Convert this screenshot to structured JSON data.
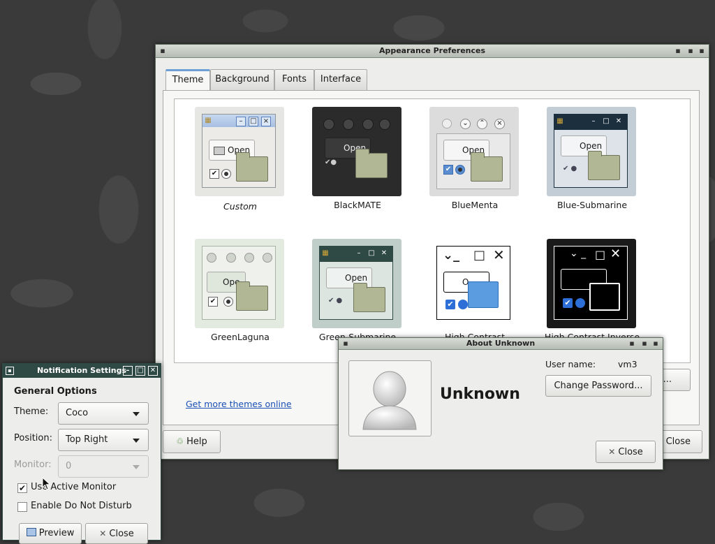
{
  "appearance": {
    "title": "Appearance Preferences",
    "tabs": [
      {
        "label": "Theme"
      },
      {
        "label": "Background"
      },
      {
        "label": "Fonts"
      },
      {
        "label": "Interface"
      }
    ],
    "themes": [
      {
        "name": "Custom",
        "open": "Open"
      },
      {
        "name": "BlackMATE",
        "open": "Open"
      },
      {
        "name": "BlueMenta",
        "open": "Open"
      },
      {
        "name": "Blue-Submarine",
        "open": "Open"
      },
      {
        "name": "GreenLaguna",
        "open": "Ope"
      },
      {
        "name": "Green-Submarine",
        "open": "Open"
      },
      {
        "name": "High Contrast",
        "open": "O"
      },
      {
        "name": "High Contrast Inverse",
        "open": ""
      }
    ],
    "more_themes_link": "Get more themes online",
    "install_button": "...",
    "help_button": "Help",
    "close_button": "Close"
  },
  "about": {
    "title": "About Unknown",
    "user_name_label": "User name:",
    "user_name_value": "vm3",
    "change_password_button": "Change Password...",
    "full_name": "Unknown",
    "close_button": "Close"
  },
  "notification": {
    "title": "Notification Settings",
    "section_title": "General Options",
    "theme_label": "Theme:",
    "theme_value": "Coco",
    "position_label": "Position:",
    "position_value": "Top Right",
    "monitor_label": "Monitor:",
    "monitor_value": "0",
    "use_active_monitor": "Use Active Monitor",
    "use_active_monitor_checked": true,
    "do_not_disturb": "Enable Do Not Disturb",
    "do_not_disturb_checked": false,
    "preview_button": "Preview",
    "close_button": "Close"
  },
  "colors": {
    "tab_accent": "#6d9fd6",
    "link": "#1a4fb5",
    "titlebar_dark": "#2f4a44"
  }
}
